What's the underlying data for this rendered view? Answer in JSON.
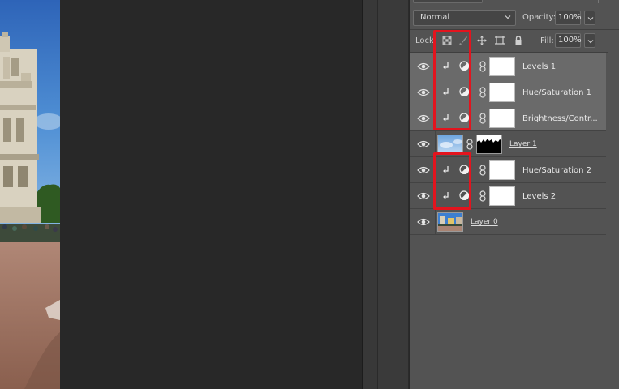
{
  "panel": {
    "blend_mode": "Normal",
    "opacity_label": "Opacity:",
    "opacity_value": "100%",
    "lock_label": "Lock:",
    "fill_label": "Fill:",
    "fill_value": "100%"
  },
  "icons": {
    "lock_transparent": "checkerboard-icon",
    "lock_image": "brush-icon",
    "lock_position": "move-icon",
    "lock_artboard": "artboard-icon",
    "lock_all": "padlock-icon",
    "visibility": "eye-icon",
    "clipping": "clip-arrow-icon",
    "adjustment": "half-circle-icon",
    "link": "chain-icon"
  },
  "layers": [
    {
      "name": "Levels 1",
      "type": "adjustment",
      "clipped": true,
      "selected": true
    },
    {
      "name": "Hue/Saturation 1",
      "type": "adjustment",
      "clipped": true,
      "selected": true
    },
    {
      "name": "Brightness/Contr...",
      "type": "adjustment",
      "clipped": true,
      "selected": true
    },
    {
      "name": "Layer 1",
      "type": "pixel-with-mask",
      "clipped": false,
      "selected": false
    },
    {
      "name": "Hue/Saturation 2",
      "type": "adjustment",
      "clipped": true,
      "selected": false
    },
    {
      "name": "Levels 2",
      "type": "adjustment",
      "clipped": true,
      "selected": false
    },
    {
      "name": "Layer 0",
      "type": "pixel",
      "clipped": false,
      "selected": false
    }
  ],
  "highlight_color": "#e3141e",
  "selected_row_color": "#6a6a6a"
}
